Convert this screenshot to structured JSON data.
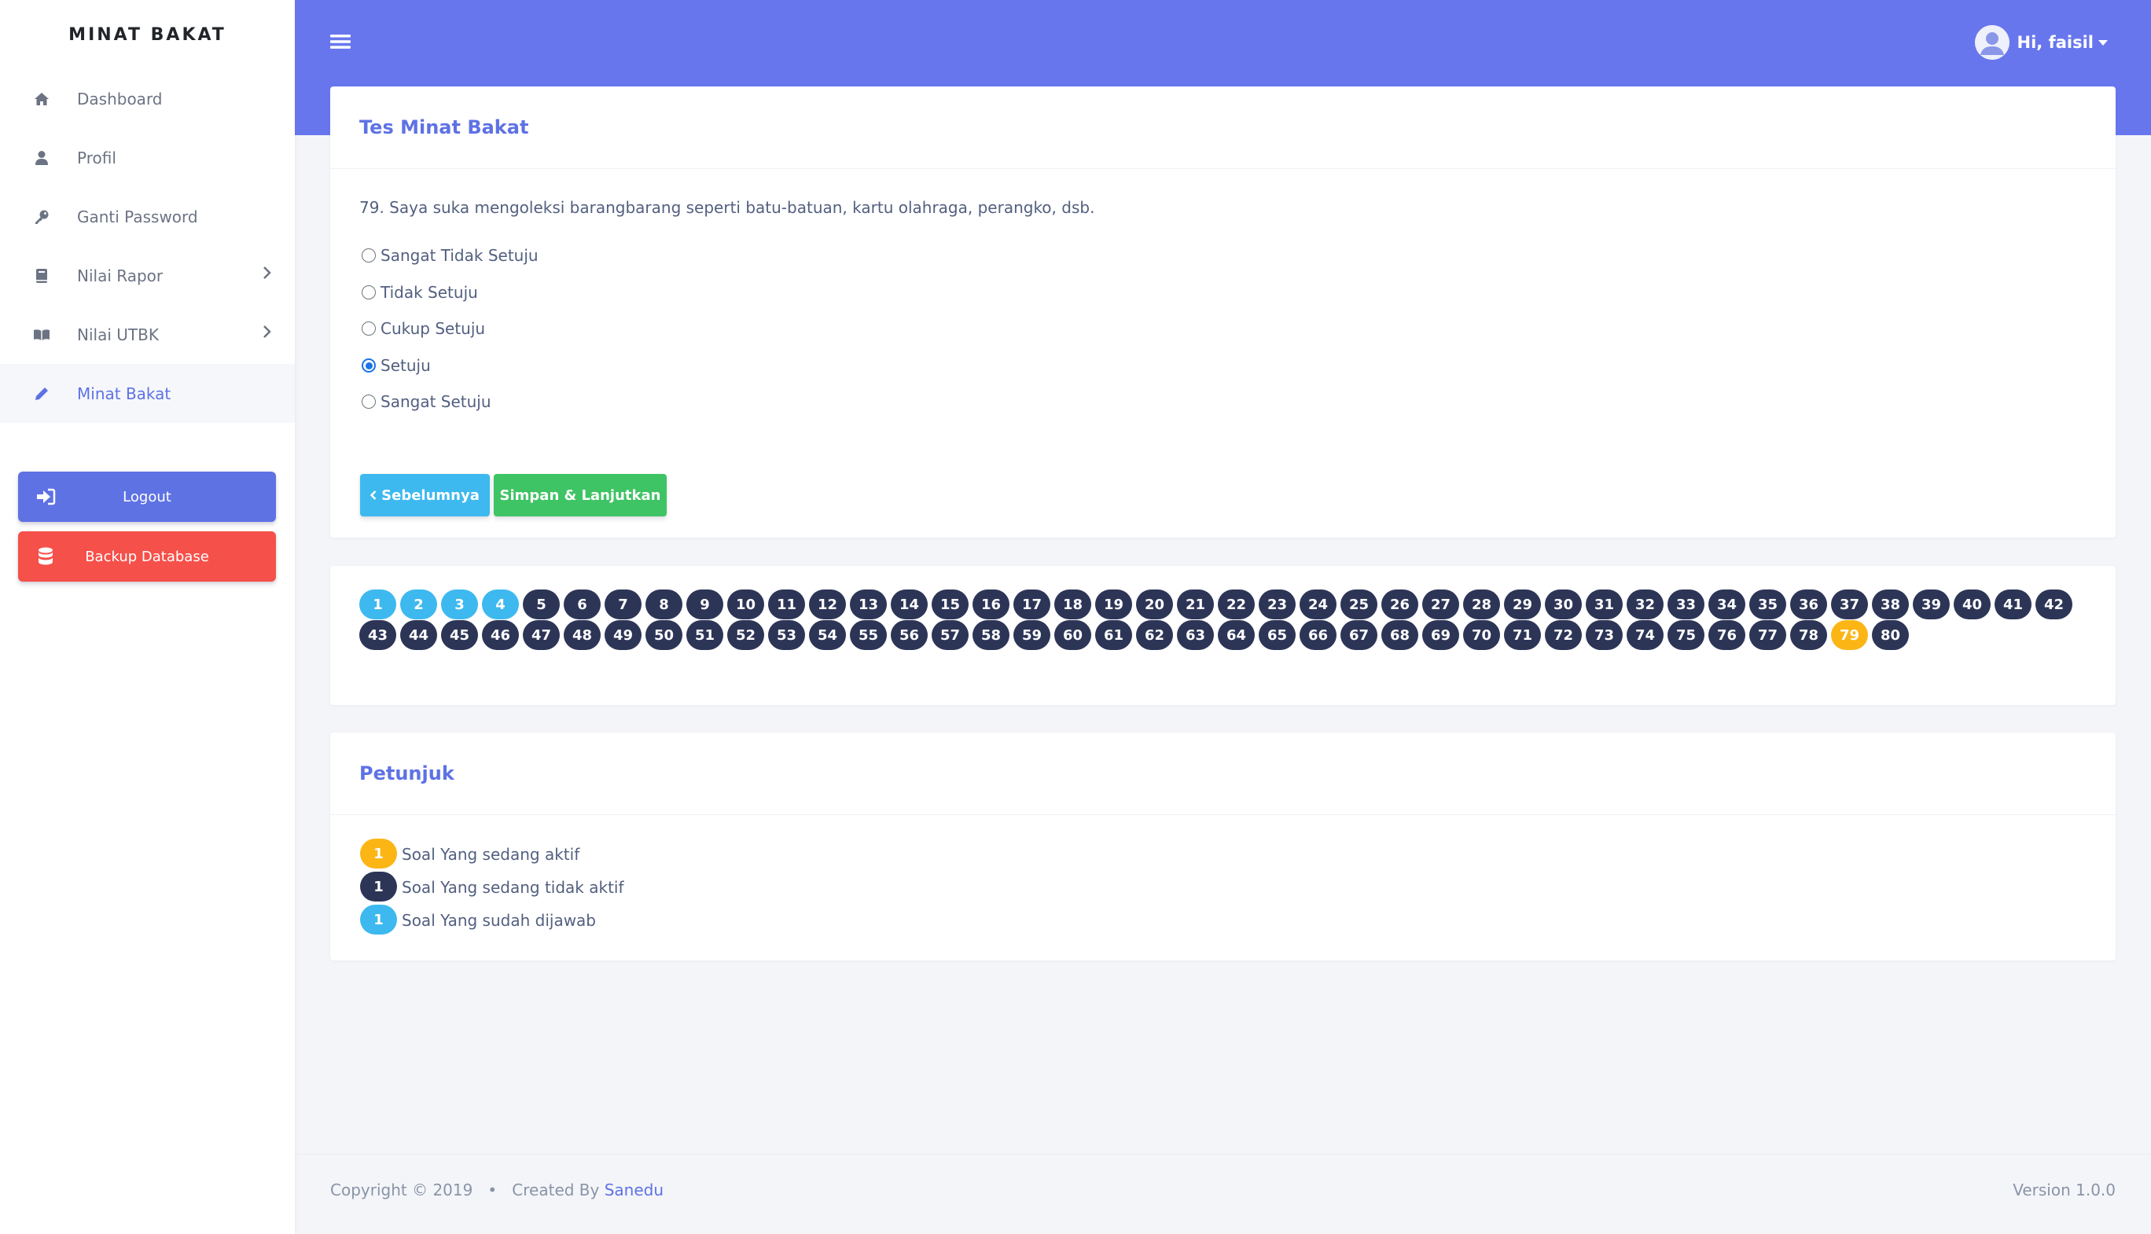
{
  "sidebar": {
    "brand": "MINAT BAKAT",
    "items": [
      {
        "label": "Dashboard",
        "icon": "home-icon"
      },
      {
        "label": "Profil",
        "icon": "user-icon"
      },
      {
        "label": "Ganti Password",
        "icon": "key-icon"
      },
      {
        "label": "Nilai Rapor",
        "icon": "book-icon"
      },
      {
        "label": "Nilai UTBK",
        "icon": "open-book-icon"
      },
      {
        "label": "Minat Bakat",
        "icon": "pencil-icon"
      }
    ],
    "logout_label": "Logout",
    "backup_label": "Backup Database"
  },
  "header": {
    "greeting": "Hi, faisil"
  },
  "test": {
    "title": "Tes Minat Bakat",
    "question": "79. Saya suka mengoleksi barangbarang seperti batu-batuan, kartu olahraga, perangko, dsb.",
    "options": [
      "Sangat Tidak Setuju",
      "Tidak Setuju",
      "Cukup Setuju",
      "Setuju",
      "Sangat Setuju"
    ],
    "selected_option": "Setuju",
    "prev_label": "Sebelumnya",
    "next_label": "Simpan & Lanjutkan"
  },
  "question_nav": {
    "total": 80,
    "answered": [
      1,
      2,
      3,
      4
    ],
    "current": 79
  },
  "guide": {
    "title": "Petunjuk",
    "items": [
      {
        "badge": "1",
        "label": "Soal Yang sedang aktif"
      },
      {
        "badge": "1",
        "label": "Soal Yang sedang tidak aktif"
      },
      {
        "badge": "1",
        "label": "Soal Yang sudah dijawab"
      }
    ]
  },
  "footer": {
    "copyright": "Copyright © 2019",
    "created_by": "Created By",
    "author": "Sanedu",
    "version": "Version 1.0.0"
  },
  "colors": {
    "primary": "#5e72e4",
    "header": "#6876ed",
    "answered": "#3db9ef",
    "current": "#fbb616",
    "inactive": "#2d3557",
    "success": "#3ec464",
    "danger": "#f5504a"
  }
}
